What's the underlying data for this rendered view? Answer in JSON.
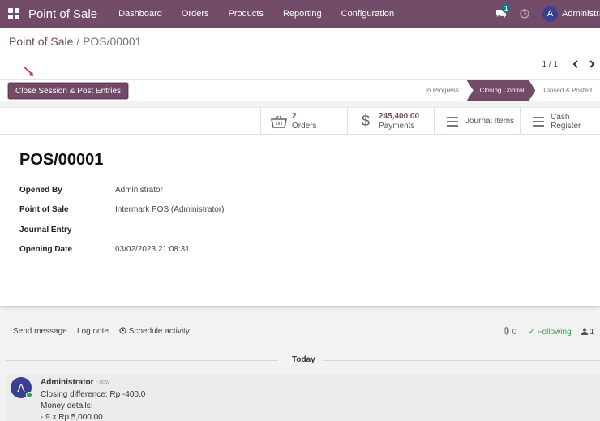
{
  "navbar": {
    "brand": "Point of Sale",
    "menu": [
      "Dashboard",
      "Orders",
      "Products",
      "Reporting",
      "Configuration"
    ],
    "chat_badge": "1",
    "avatar_letter": "A",
    "user_name": "Administrator"
  },
  "breadcrumb": {
    "parent": "Point of Sale",
    "separator": "/",
    "current": "POS/00001"
  },
  "pager": {
    "value": "1 / 1",
    "prev": "‹",
    "next": "›"
  },
  "actions": {
    "close_session": "Close Session & Post Entries"
  },
  "stages": {
    "in_progress": "In Progress",
    "closing_control": "Closing Control",
    "closed_posted": "Closed & Posted",
    "active": "Closing Control"
  },
  "smart_buttons": {
    "orders_count": "2",
    "orders_label": "Orders",
    "payments_value": "245,400.00",
    "payments_label": "Payments",
    "journal_items": "Journal Items",
    "cash_register": "Cash Register"
  },
  "record": {
    "title": "POS/00001",
    "fields": {
      "opened_by_label": "Opened By",
      "opened_by_value": "Administrator",
      "pos_label": "Point of Sale",
      "pos_value": "Intermark POS (Administrator)",
      "journal_entry_label": "Journal Entry",
      "journal_entry_value": "",
      "opening_date_label": "Opening Date",
      "opening_date_value": "03/02/2023 21:08:31"
    }
  },
  "chatter": {
    "send_message": "Send message",
    "log_note": "Log note",
    "schedule_activity": "Schedule activity",
    "attachments_count": "0",
    "following": "Following",
    "followers_count": "1",
    "today": "Today",
    "message": {
      "avatar_letter": "A",
      "author": "Administrator",
      "time": "- now",
      "line1": "Closing difference: Rp -400.0",
      "line2": "Money details:",
      "line3": "- 9 x Rp 5,000.00"
    }
  },
  "colors": {
    "brand": "#714b67",
    "following": "#28a745",
    "annotation_arrow": "#e8245a"
  }
}
